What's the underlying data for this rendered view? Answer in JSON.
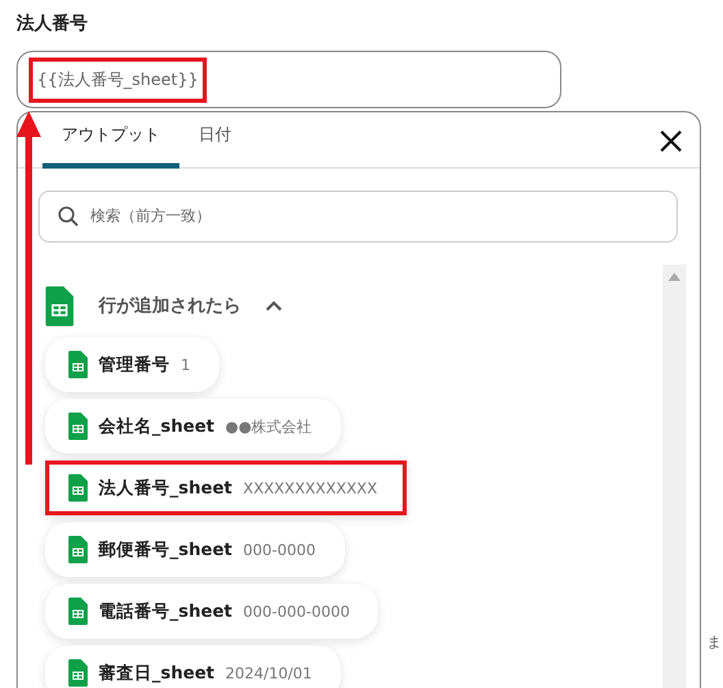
{
  "field": {
    "label": "法人番号",
    "value": "{{法人番号_sheet}}",
    "highlighted": true
  },
  "tabs": [
    {
      "label": "アウトプット",
      "selected": true
    },
    {
      "label": "日付",
      "selected": false
    }
  ],
  "search": {
    "placeholder": "検索（前方一致）"
  },
  "group": {
    "title": "行が追加されたら",
    "expanded": true,
    "items": [
      {
        "name": "管理番号",
        "value": "1",
        "highlighted": false
      },
      {
        "name": "会社名_sheet",
        "value": "●●株式会社",
        "highlighted": false
      },
      {
        "name": "法人番号_sheet",
        "value": "XXXXXXXXXXXXX",
        "highlighted": true
      },
      {
        "name": "郵便番号_sheet",
        "value": "000-0000",
        "highlighted": false
      },
      {
        "name": "電話番号_sheet",
        "value": "000-000-0000",
        "highlighted": false
      },
      {
        "name": "審査日_sheet",
        "value": "2024/10/01",
        "highlighted": false
      }
    ]
  },
  "side_text": "ま"
}
